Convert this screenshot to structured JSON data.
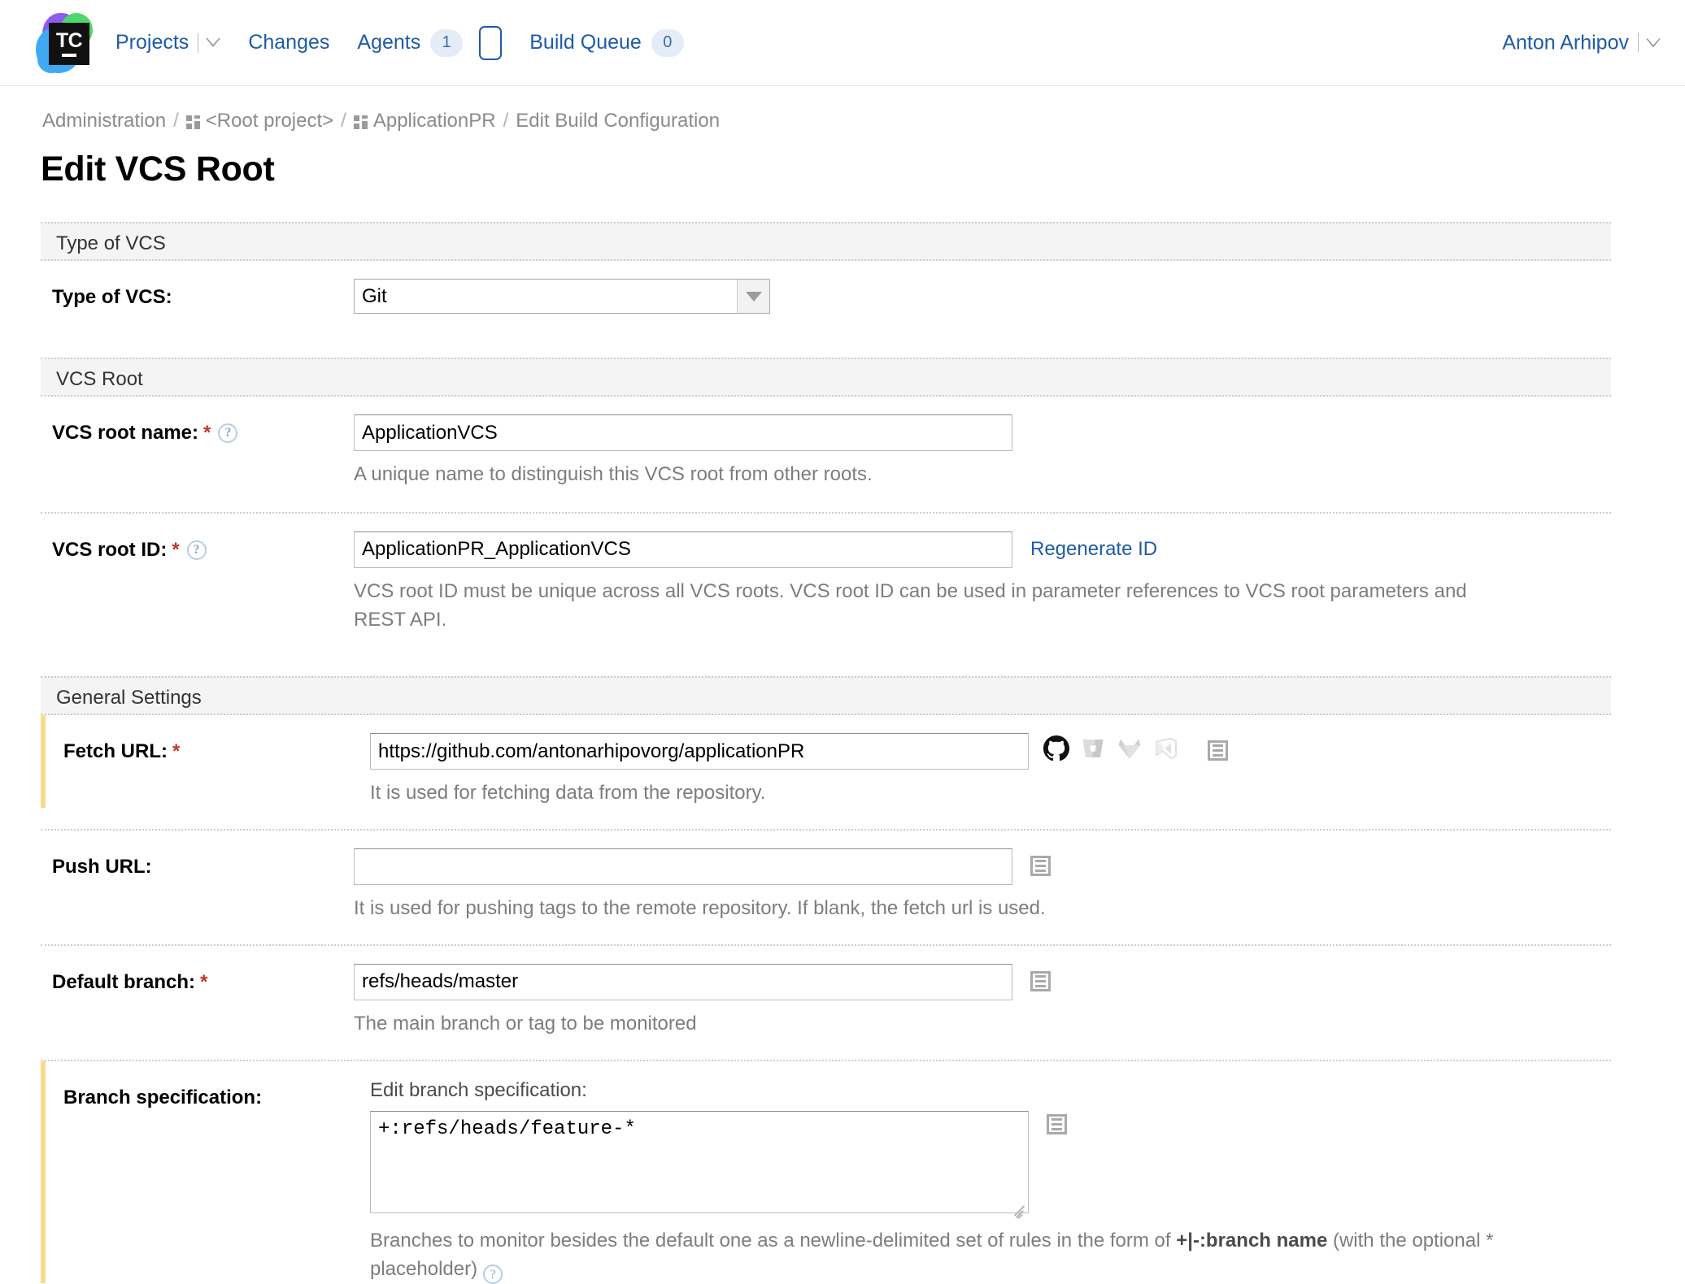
{
  "header": {
    "logo_text": "TC",
    "nav": [
      {
        "label": "Projects",
        "icon": "chevron-down-icon",
        "has_caret": true,
        "badge": null
      },
      {
        "label": "Changes",
        "icon": null,
        "has_caret": false,
        "badge": null
      },
      {
        "label": "Agents",
        "icon": null,
        "has_caret": false,
        "badge": "1"
      },
      {
        "label": "Build Queue",
        "icon": null,
        "has_caret": false,
        "badge": "0"
      }
    ],
    "user": "Anton Arhipov"
  },
  "breadcrumb": {
    "items": [
      {
        "label": "Administration",
        "icon": null
      },
      {
        "label": "<Root project>",
        "icon": "grid-icon"
      },
      {
        "label": "ApplicationPR",
        "icon": "grid-icon"
      },
      {
        "label": "Edit Build Configuration",
        "icon": null
      }
    ],
    "separator": "/"
  },
  "page": {
    "title": "Edit VCS Root"
  },
  "sections": {
    "type_of_vcs": {
      "header": "Type of VCS",
      "label": "Type of VCS:",
      "value": "Git",
      "options": [
        "Git"
      ]
    },
    "vcs_root": {
      "header": "VCS Root",
      "name": {
        "label": "VCS root name:",
        "required_mark": "*",
        "value": "ApplicationVCS",
        "hint": "A unique name to distinguish this VCS root from other roots."
      },
      "id": {
        "label": "VCS root ID:",
        "required_mark": "*",
        "value": "ApplicationPR_ApplicationVCS",
        "action_link": "Regenerate ID",
        "hint": "VCS root ID must be unique across all VCS roots. VCS root ID can be used in parameter references to VCS root parameters and REST API."
      }
    },
    "general_settings": {
      "header": "General Settings",
      "fetch_url": {
        "label": "Fetch URL:",
        "required_mark": "*",
        "value": "https://github.com/antonarhipovorg/applicationPR",
        "hint": "It is used for fetching data from the repository.",
        "vcs_provider_icons": [
          "github-icon",
          "bitbucket-icon",
          "gitlab-icon",
          "azure-devops-icon"
        ],
        "param_icon": "parameter-list-icon"
      },
      "push_url": {
        "label": "Push URL:",
        "required_mark": "",
        "value": "",
        "placeholder": "",
        "hint": "It is used for pushing tags to the remote repository. If blank, the fetch url is used.",
        "param_icon": "parameter-list-icon"
      },
      "default_branch": {
        "label": "Default branch:",
        "required_mark": "*",
        "value": "refs/heads/master",
        "hint": "The main branch or tag to be monitored",
        "param_icon": "parameter-list-icon"
      },
      "branch_specification": {
        "label": "Branch specification:",
        "sublabel": "Edit branch specification:",
        "value": "+:refs/heads/feature-*",
        "hint_before": "Branches to monitor besides the default one as a newline-delimited set of rules in the form of ",
        "hint_bold": "+|-:branch name",
        "hint_after": " (with the optional * placeholder)",
        "param_icon": "parameter-list-icon"
      }
    }
  },
  "colors": {
    "link": "#1f5ba8",
    "required": "#c0392b",
    "modified_marker": "#f7dc8c",
    "section_bg": "#f4f4f4",
    "hint_text": "#7d7d7d"
  }
}
